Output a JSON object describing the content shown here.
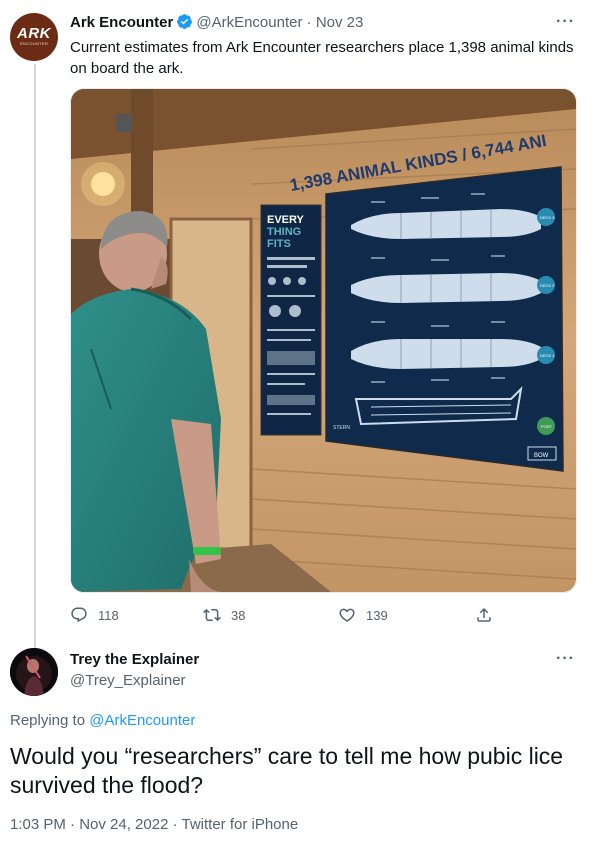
{
  "tweet1": {
    "author_name": "Ark Encounter",
    "author_handle": "@ArkEncounter",
    "date": "Nov 23",
    "avatar_text": "ARK",
    "avatar_subtext": "ENCOUNTER",
    "text": "Current estimates from Ark Encounter researchers place 1,398 animal kinds on board the ark.",
    "photo": {
      "banner_text": "1,398 ANIMAL KINDS / 6,744 ANI",
      "sign_title": [
        "EVERY",
        "THING",
        "FITS"
      ],
      "deck_labels": [
        "DECK 3",
        "DECK 2",
        "DECK 1"
      ],
      "stern_label": "STERN",
      "port_label": "PORT",
      "bow_label": "BOW"
    },
    "replies": "118",
    "retweets": "38",
    "likes": "139",
    "more": "···"
  },
  "tweet2": {
    "author_name": "Trey the Explainer",
    "author_handle": "@Trey_Explainer",
    "replying_prefix": "Replying to",
    "replying_to": "@ArkEncounter",
    "text": "Would you “researchers” care to tell me how pubic lice survived the flood?",
    "meta": "1:03 PM · Nov 24, 2022 · Twitter for iPhone",
    "more": "···"
  },
  "colors": {
    "accent": "#1d9bf0",
    "muted": "#536471",
    "text": "#0f1419",
    "thread_line": "#cfd9de"
  }
}
